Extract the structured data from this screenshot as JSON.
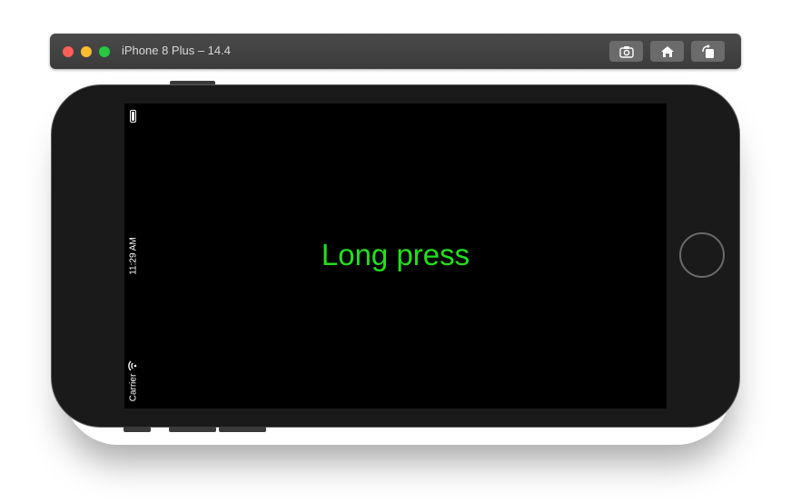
{
  "window": {
    "title": "iPhone 8 Plus – 14.4",
    "toolbar": {
      "screenshot_icon": "camera-icon",
      "home_icon": "home-icon",
      "rotate_icon": "rotate-icon"
    }
  },
  "status_bar": {
    "time": "11:29 AM",
    "carrier": "Carrier",
    "wifi_icon": "wifi-icon",
    "battery_icon": "battery-icon"
  },
  "screen": {
    "label": "Long press",
    "label_color": "#22e01c",
    "background": "#000000"
  }
}
